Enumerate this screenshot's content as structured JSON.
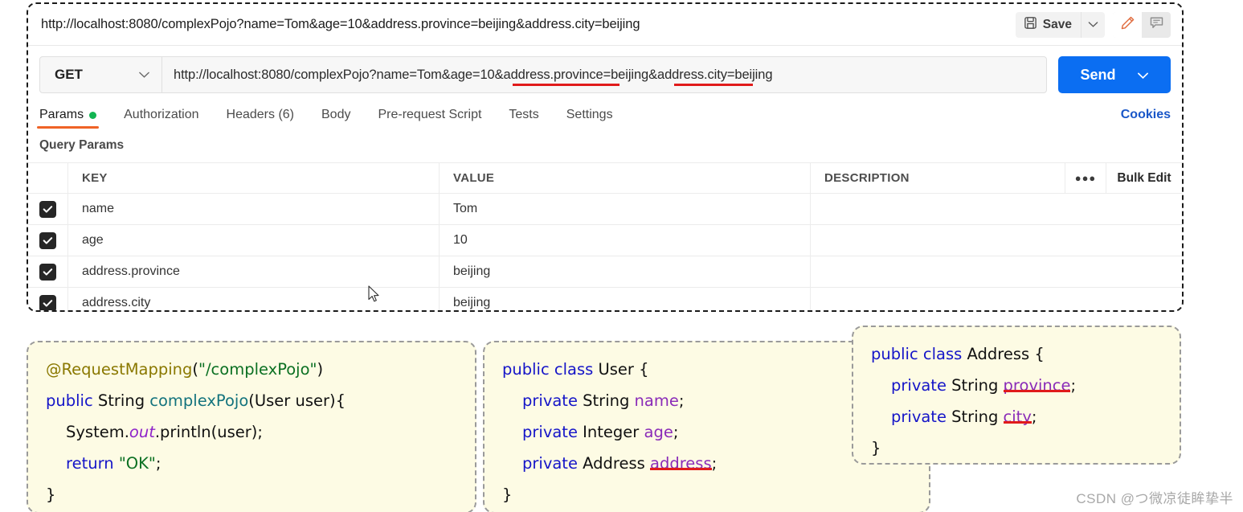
{
  "request_crumb": {
    "url": "http://localhost:8080/complexPojo?name=Tom&age=10&address.province=beijing&address.city=beijing",
    "save_label": "Save",
    "save_icon": "floppy-disk-icon",
    "save_caret_icon": "chevron-down-icon",
    "edit_icon": "pencil-icon",
    "comment_icon": "comment-icon"
  },
  "request": {
    "method": "GET",
    "method_caret_icon": "chevron-down-icon",
    "url": "http://localhost:8080/complexPojo?name=Tom&age=10&address.province=beijing&address.city=beijing",
    "send_label": "Send",
    "send_caret_icon": "chevron-down-icon",
    "accent_color": "#0b6ef2",
    "annotation_color": "#e01b1b"
  },
  "tabs": [
    {
      "label": "Params",
      "active": true,
      "badge_dot": true
    },
    {
      "label": "Authorization",
      "active": false
    },
    {
      "label": "Headers (6)",
      "active": false
    },
    {
      "label": "Body",
      "active": false
    },
    {
      "label": "Pre-request Script",
      "active": false
    },
    {
      "label": "Tests",
      "active": false
    },
    {
      "label": "Settings",
      "active": false
    }
  ],
  "cookies_label": "Cookies",
  "query_params": {
    "section_title": "Query Params",
    "columns": {
      "key": "KEY",
      "value": "VALUE",
      "description": "DESCRIPTION"
    },
    "more_icon": "kebab-menu-icon",
    "bulk_edit_label": "Bulk Edit",
    "rows": [
      {
        "checked": true,
        "key": "name",
        "value": "Tom",
        "description": ""
      },
      {
        "checked": true,
        "key": "age",
        "value": "10",
        "description": ""
      },
      {
        "checked": true,
        "key": "address.province",
        "value": "beijing",
        "description": ""
      },
      {
        "checked": true,
        "key": "address.city",
        "value": "beijing",
        "description": ""
      }
    ]
  },
  "code_blocks": {
    "controller": {
      "l1_anno": "@RequestMapping",
      "l1_open": "(",
      "l1_str": "\"/complexPojo\"",
      "l1_close": ")",
      "l2_kw": "public",
      "l2_type": " String ",
      "l2_method": "complexPojo",
      "l2_rest": "(User user){",
      "l3": "System.",
      "l3_static": "out",
      "l3_rest": ".println(user);",
      "l4_kw": "return",
      "l4_str": "\"OK\"",
      "l4_semi": ";",
      "l5": "}"
    },
    "user_class": {
      "l1_kw": "public class",
      "l1_name": " User {",
      "l2_kw": "private",
      "l2_type": " String ",
      "l2_field": "name",
      "l2_semi": ";",
      "l3_kw": "private",
      "l3_type": " Integer ",
      "l3_field": "age",
      "l3_semi": ";",
      "l4_kw": "private",
      "l4_type": " Address ",
      "l4_field": "address",
      "l4_semi": ";",
      "l5": "}"
    },
    "address_class": {
      "l1_kw": "public class",
      "l1_name": " Address {",
      "l2_kw": "private",
      "l2_type": " String ",
      "l2_field": "province",
      "l2_semi": ";",
      "l3_kw": "private",
      "l3_type": " String ",
      "l3_field": "city",
      "l3_semi": ";",
      "l4": "}"
    }
  },
  "watermark": "CSDN @つ微凉徒眸挚半"
}
